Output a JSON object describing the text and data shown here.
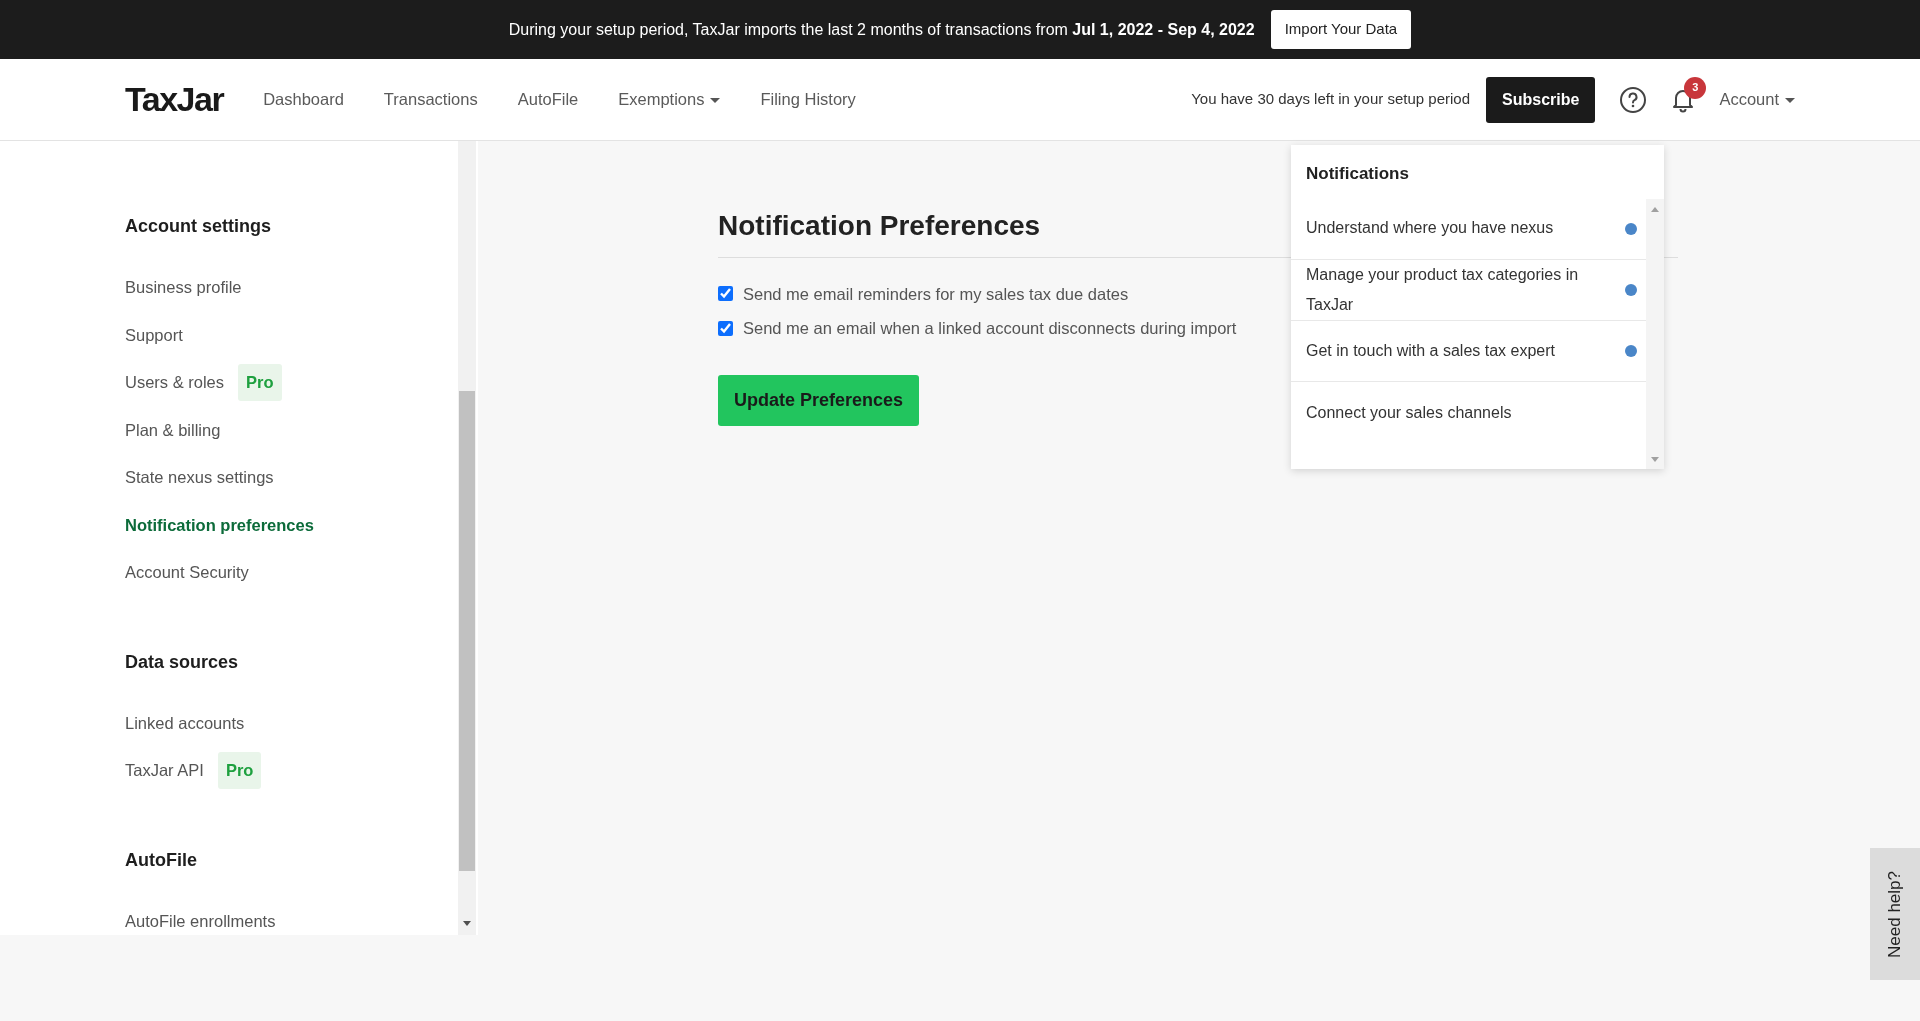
{
  "banner": {
    "text": "During your setup period, TaxJar imports the last 2 months of transactions from **Jul 1, 2022 - Sep 4, 2022**",
    "button": "Import Your Data"
  },
  "navbar": {
    "logo": "TaxJar",
    "items": [
      {
        "label": "Dashboard",
        "dropdown": false
      },
      {
        "label": "Transactions",
        "dropdown": false
      },
      {
        "label": "AutoFile",
        "dropdown": false
      },
      {
        "label": "Exemptions",
        "dropdown": true
      },
      {
        "label": "Filing History",
        "dropdown": false
      }
    ],
    "setup_notice": "You have 30 days left in your setup period",
    "subscribe": "Subscribe",
    "notification_count": "3",
    "account": "Account"
  },
  "sidebar": {
    "sections": [
      {
        "title": "Account settings",
        "items": [
          {
            "label": "Business profile",
            "selected": false
          },
          {
            "label": "Support",
            "selected": false
          },
          {
            "label": "Users & roles",
            "selected": false,
            "badge": "Pro"
          },
          {
            "label": "Plan & billing",
            "selected": false
          },
          {
            "label": "State nexus settings",
            "selected": false
          },
          {
            "label": "Notification preferences",
            "selected": true
          },
          {
            "label": "Account Security",
            "selected": false
          }
        ]
      },
      {
        "title": "Data sources",
        "items": [
          {
            "label": "Linked accounts",
            "selected": false
          },
          {
            "label": "TaxJar API",
            "selected": false,
            "badge": "Pro"
          }
        ]
      },
      {
        "title": "AutoFile",
        "items": [
          {
            "label": "AutoFile enrollments",
            "selected": false
          }
        ]
      }
    ]
  },
  "main": {
    "title": "Notification Preferences",
    "options": [
      {
        "label": "Send me email reminders for my sales tax due dates",
        "checked": true
      },
      {
        "label": "Send me an email when a linked account disconnects during import",
        "checked": true
      }
    ],
    "button": "Update Preferences"
  },
  "notifications": {
    "title": "Notifications",
    "items": [
      {
        "text": "Understand where you have nexus",
        "unread": true
      },
      {
        "text": "Manage your product tax categories in TaxJar",
        "unread": true
      },
      {
        "text": "Get in touch with a sales tax expert",
        "unread": true
      },
      {
        "text": "Connect your sales channels",
        "unread": false
      }
    ]
  },
  "help_tab": "Need help?"
}
